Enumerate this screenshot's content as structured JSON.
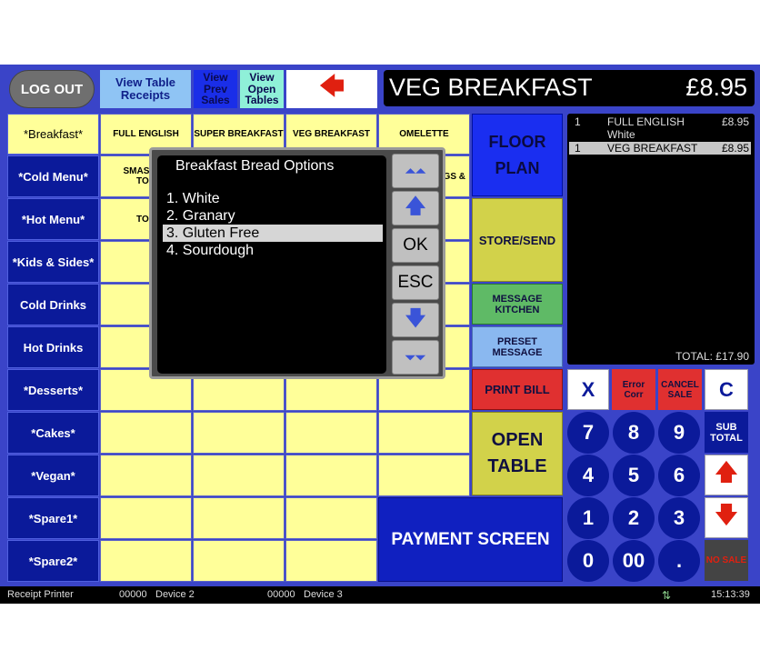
{
  "header": {
    "logout": "LOG OUT",
    "view_table_receipts": [
      "View Table",
      "Receipts"
    ],
    "view_prev_sales": [
      "View",
      "Prev",
      "Sales"
    ],
    "view_open_tables": [
      "View",
      "Open",
      "Tables"
    ],
    "back_arrow": "🡄",
    "item_name": "VEG BREAKFAST",
    "item_price": "£8.95"
  },
  "categories": [
    "*Breakfast*",
    "*Cold Menu*",
    "*Hot Menu*",
    "*Kids & Sides*",
    "Cold Drinks",
    "Hot Drinks",
    "*Desserts*",
    "*Cakes*",
    "*Vegan*",
    "*Spare1*",
    "*Spare2*"
  ],
  "items": {
    "row1": [
      "FULL ENGLISH",
      "SUPER BREAKFAST",
      "VEG BREAKFAST",
      "OMELETTE"
    ],
    "row2_first": [
      "SMASHED",
      "TOA"
    ],
    "row2_last": "GS &",
    "row3_first": "TOA"
  },
  "receipt": {
    "lines": [
      {
        "qty": "1",
        "name": "FULL ENGLISH",
        "price": "£8.95",
        "note": "White"
      },
      {
        "qty": "1",
        "name": "VEG BREAKFAST",
        "price": "£8.95"
      }
    ],
    "total": "TOTAL: £17.90"
  },
  "actions": {
    "floor_plan": [
      "FLOOR",
      "PLAN"
    ],
    "store_send": "STORE/SEND",
    "message_kitchen": "MESSAGE KITCHEN",
    "preset_message": "PRESET MESSAGE",
    "print_bill": "PRINT BILL",
    "open_table": [
      "OPEN",
      "TABLE"
    ],
    "payment_screen": "PAYMENT SCREEN"
  },
  "keypad": {
    "x": "X",
    "error_corr": [
      "Error",
      "Corr"
    ],
    "cancel_sale": [
      "CANCEL",
      "SALE"
    ],
    "c": "C",
    "subtotal": [
      "SUB",
      "TOTAL"
    ],
    "no_sale": "NO SALE",
    "digits": [
      "7",
      "8",
      "9",
      "4",
      "5",
      "6",
      "1",
      "2",
      "3",
      "0",
      "00",
      "."
    ],
    "up_arrow": "🡅",
    "down_arrow": "🡇"
  },
  "dialog": {
    "title": "Breakfast Bread Options",
    "options": [
      "1. White",
      "2. Granary",
      "3. Gluten Free",
      "4. Sourdough"
    ],
    "ok": "OK",
    "esc": "ESC",
    "page_up": "⏶⏶",
    "up": "🡅",
    "down": "🡇",
    "page_down": "⏷⏷"
  },
  "status": {
    "receipt_printer": "Receipt Printer",
    "device2_code": "00000",
    "device2": "Device 2",
    "device3_code": "00000",
    "device3": "Device 3",
    "time": "15:13:39"
  },
  "colors": {
    "background": "#3a44c8",
    "category": "#0b1a9a",
    "item": "#ffff99",
    "floor_plan": "#1a2ef0",
    "store_send": "#d2d24a",
    "message_kitchen": "#5fba66",
    "preset_message": "#8ab8f0",
    "print_bill": "#e03030",
    "payment_screen": "#1020c0"
  }
}
